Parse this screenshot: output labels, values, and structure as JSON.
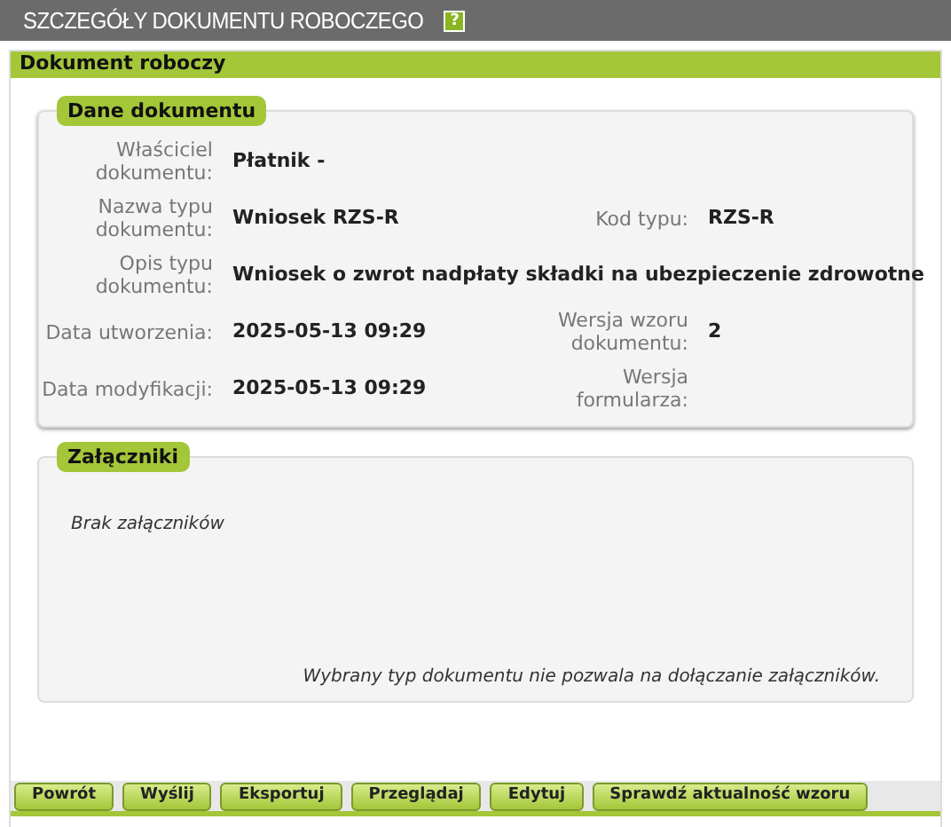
{
  "header": {
    "title": "SZCZEGÓŁY DOKUMENTU ROBOCZEGO",
    "help": "?"
  },
  "panel": {
    "title": "Dokument roboczy"
  },
  "details": {
    "title": "Dane dokumentu",
    "rows": [
      [
        {
          "label": "Właściciel dokumentu:",
          "value": "Płatnik -"
        }
      ],
      [
        {
          "label": "Nazwa typu dokumentu:",
          "value": "Wniosek RZS-R"
        },
        {
          "label": "Kod typu:",
          "value": "RZS-R"
        }
      ],
      [
        {
          "label": "Opis typu dokumentu:",
          "value": "Wniosek o zwrot nadpłaty składki na ubezpieczenie zdrowotne"
        }
      ],
      [
        {
          "label": "Data utworzenia:",
          "value": "2025-05-13 09:29"
        },
        {
          "label": "Wersja wzoru dokumentu:",
          "value": "2"
        }
      ],
      [
        {
          "label": "Data modyfikacji:",
          "value": "2025-05-13 09:29"
        },
        {
          "label": "Wersja formularza:"
        }
      ]
    ]
  },
  "attachments": {
    "title": "Załączniki",
    "empty": "Brak załączników",
    "note": "Wybrany typ dokumentu nie pozwala na dołączanie załączników."
  },
  "buttons": [
    "Powrót",
    "Wyślij",
    "Eksportuj",
    "Przeglądaj",
    "Edytuj",
    "Sprawdź aktualność wzoru"
  ]
}
